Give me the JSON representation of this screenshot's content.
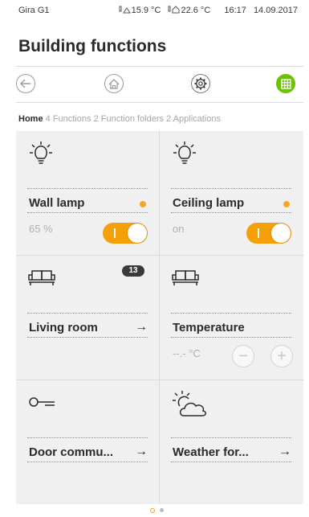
{
  "status_bar": {
    "device": "Gira G1",
    "outdoor_temp": "15.9 °C",
    "indoor_temp": "22.6 °C",
    "time": "16:17",
    "date": "14.09.2017"
  },
  "page_title": "Building functions",
  "navbar": {
    "back_icon": "back-arrow-icon",
    "home_icon": "home-icon",
    "settings_icon": "settings-gear-icon",
    "grid_icon": "grid-view-icon",
    "active_color": "#6cc400"
  },
  "breadcrumb": {
    "home": "Home",
    "functions_count": "4",
    "functions_label": "Functions",
    "folders_count": "2",
    "folders_label": "Function folders",
    "applications_count": "2",
    "applications_label": "Applications"
  },
  "tiles": [
    {
      "name": "Wall lamp",
      "value": "65 %",
      "icon": "light-bulb-icon",
      "state": "on",
      "status_dot": true
    },
    {
      "name": "Ceiling lamp",
      "value": "on",
      "icon": "light-bulb-icon",
      "state": "on",
      "status_dot": true
    },
    {
      "name": "Living room",
      "arrow": "→",
      "icon": "sofa-icon",
      "badge": "13"
    },
    {
      "name": "Temperature",
      "value": "--.- °C",
      "icon": "sofa-icon",
      "minus": "−",
      "plus": "+"
    },
    {
      "name": "Door commu...",
      "arrow": "→",
      "icon": "key-icon"
    },
    {
      "name": "Weather for...",
      "arrow": "→",
      "icon": "weather-sun-cloud-icon"
    }
  ],
  "pagination": {
    "current_page": 1,
    "total_pages": 2
  },
  "colors": {
    "accent": "#f5a009",
    "active_nav": "#6cc400",
    "tile_bg": "#f0f0f0"
  }
}
